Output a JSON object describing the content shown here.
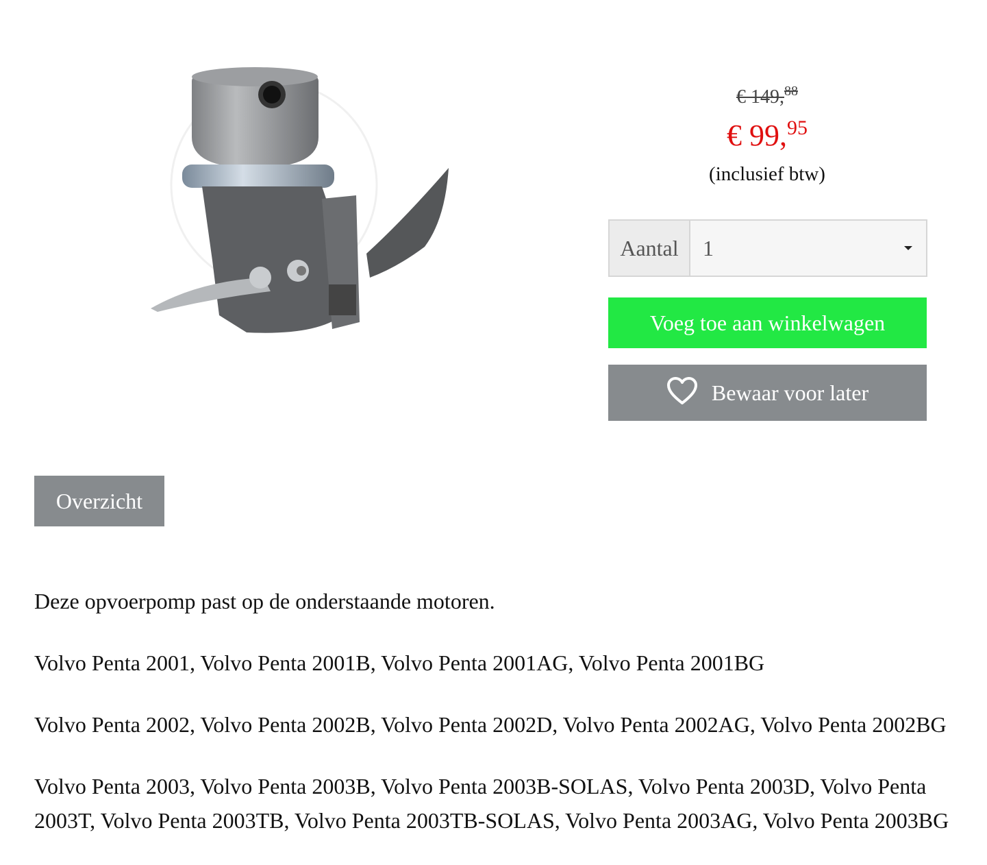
{
  "product": {
    "image_alt": "opvoerpomp",
    "price_old_main": "€ 149,",
    "price_old_cents": "88",
    "price_new_main": "€ 99,",
    "price_new_cents": "95",
    "price_note": "(inclusief btw)"
  },
  "quantity": {
    "label": "Aantal",
    "selected": "1"
  },
  "buttons": {
    "add_to_cart": "Voeg toe aan winkelwagen",
    "save_for_later": "Bewaar voor later"
  },
  "tabs": {
    "overview": "Overzicht"
  },
  "description": {
    "intro": "Deze opvoerpomp past op de onderstaande motoren.",
    "line_2001": "Volvo Penta 2001, Volvo Penta 2001B, Volvo Penta 2001AG, Volvo Penta 2001BG",
    "line_2002": "Volvo Penta 2002, Volvo Penta 2002B, Volvo Penta 2002D, Volvo Penta 2002AG, Volvo Penta 2002BG",
    "line_2003": "Volvo Penta 2003, Volvo Penta 2003B, Volvo Penta 2003B-SOLAS, Volvo Penta 2003D, Volvo Penta 2003T, Volvo Penta 2003TB, Volvo Penta 2003TB-SOLAS, Volvo Penta 2003AG, Volvo Penta 2003BG"
  },
  "icons": {
    "heart": "heart-icon",
    "caret": "caret-down-icon"
  },
  "colors": {
    "price_new": "#e01010",
    "cart_button": "#22e844",
    "grey_button": "#878b8e"
  }
}
